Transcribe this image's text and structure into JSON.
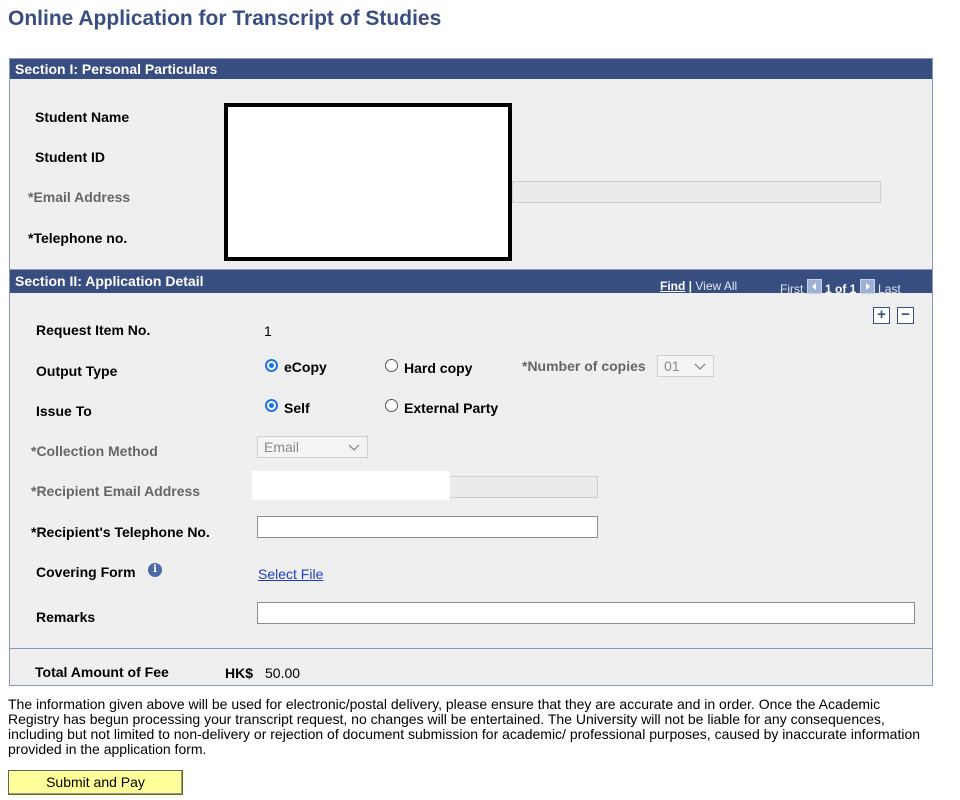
{
  "page_title": "Online Application for Transcript of Studies",
  "section1": {
    "heading": "Section I: Personal Particulars",
    "student_name_label": "Student Name",
    "student_id_label": "Student ID",
    "email_label": "*Email Address",
    "telephone_label": "*Telephone no."
  },
  "section2": {
    "heading": "Section II: Application Detail",
    "nav": {
      "find": "Find",
      "separator": " | ",
      "view_all": "View All",
      "first": "First",
      "page": "1 of 1",
      "last": "Last"
    },
    "add_row": "+",
    "delete_row": "−",
    "request_item_label": "Request Item No.",
    "request_item_value": "1",
    "output_type_label": "Output Type",
    "output_options": [
      {
        "label": "eCopy",
        "selected": true
      },
      {
        "label": "Hard copy",
        "selected": false
      }
    ],
    "copies_label": "*Number of copies",
    "copies_value": "01",
    "issue_to_label": "Issue To",
    "issue_options": [
      {
        "label": "Self",
        "selected": true
      },
      {
        "label": "External Party",
        "selected": false
      }
    ],
    "collection_method_label": "*Collection Method",
    "collection_method_value": "Email",
    "recipient_email_label": "*Recipient Email Address",
    "recipient_phone_label": "*Recipient's Telephone No.",
    "recipient_phone_value": "",
    "covering_form_label": "Covering Form",
    "select_file_link": "Select File",
    "remarks_label": "Remarks",
    "remarks_value": "",
    "total_label": "Total Amount of Fee",
    "currency": "HK$",
    "total_value": "50.00"
  },
  "disclaimer": "The information given above will be used for electronic/postal delivery, please ensure that they are accurate and in order. Once the Academic Registry has begun processing your transcript request, no changes will be entertained. The University will not be liable for any consequences, including but not limited to non-delivery or rejection of document submission for academic/ professional purposes, caused by inaccurate information provided in the application form.",
  "submit_button": "Submit and Pay",
  "colors": {
    "header_blue": "#384e80",
    "panel_bg": "#efefef",
    "submit_yellow": "#ffff99",
    "link_blue": "#1f3ec2"
  },
  "icons": {
    "info": "info-circle-icon",
    "first": "nav-first-icon",
    "last": "nav-last-icon",
    "dropdown": "chevron-down-icon"
  }
}
